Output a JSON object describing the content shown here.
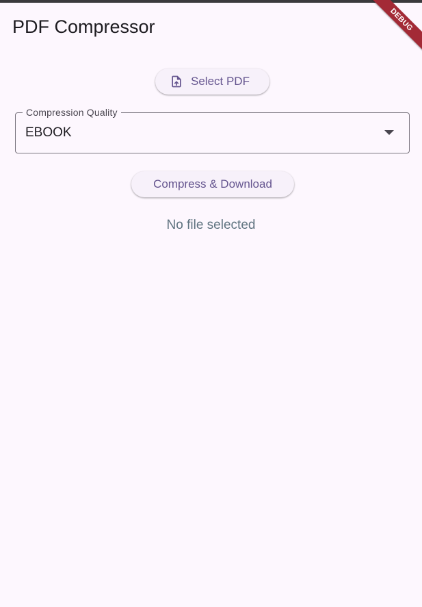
{
  "app": {
    "title": "PDF Compressor",
    "debug_label": "DEBUG"
  },
  "actions": {
    "select_pdf_label": "Select PDF",
    "select_pdf_icon": "file-upload-icon",
    "compress_label": "Compress & Download"
  },
  "quality": {
    "label": "Compression Quality",
    "selected": "EBOOK"
  },
  "status": {
    "message": "No file selected"
  },
  "colors": {
    "background": "#FDF7FE",
    "primary": "#65558F",
    "button_surface": "#F7F1FA",
    "debug_banner": "#A32A36",
    "status_text": "#5F7380"
  }
}
